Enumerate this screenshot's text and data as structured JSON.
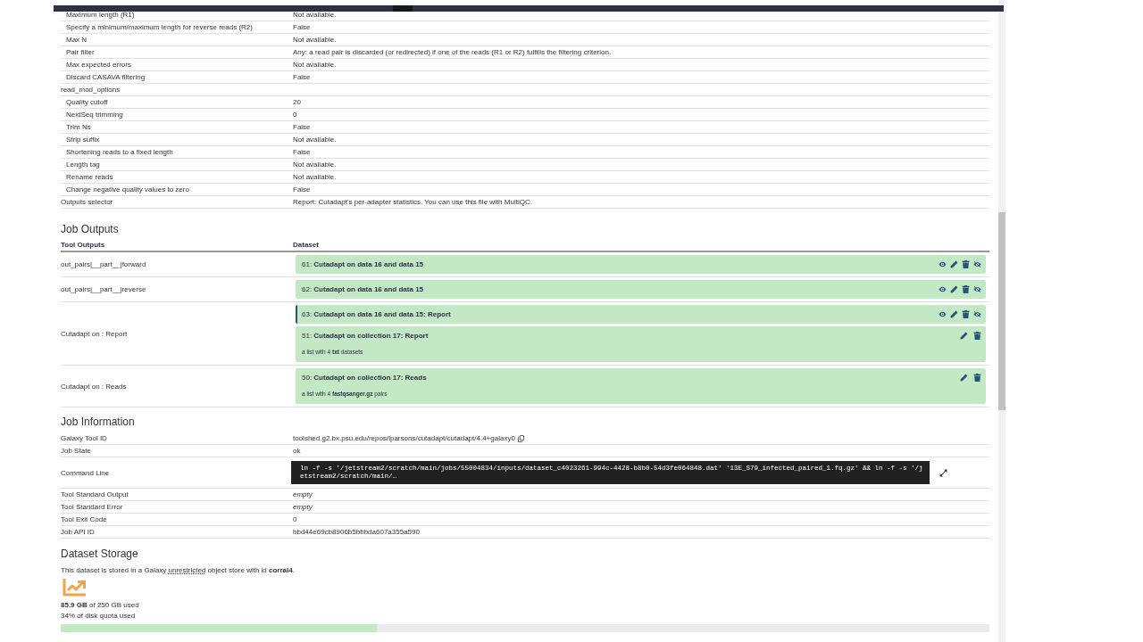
{
  "parameters": [
    {
      "children": [
        {
          "label": "Maximum length (R1)",
          "value": "Not available."
        },
        {
          "label": "Specify a minimum/maximum length for reverse reads (R2)",
          "value": "False"
        },
        {
          "label": "Max N",
          "value": "Not available."
        },
        {
          "label": "Pair filter",
          "value": "Any: a read pair is discarded (or redirected) if one of the reads (R1 or R2) fulfills the filtering criterion."
        },
        {
          "label": "Max expected errors",
          "value": "Not available."
        },
        {
          "label": "Discard CASAVA filtering",
          "value": "False"
        }
      ]
    },
    {
      "label": "read_mod_options",
      "children": [
        {
          "label": "Quality cutoff",
          "value": "20"
        },
        {
          "label": "NextSeq trimming",
          "value": "0"
        },
        {
          "label": "Trim Ns",
          "value": "False"
        },
        {
          "label": "Strip suffix",
          "value": "Not available."
        },
        {
          "label": "Shortening reads to a fixed length",
          "value": "False"
        },
        {
          "label": "Length tag",
          "value": "Not available."
        },
        {
          "label": "Rename reads",
          "value": "Not available."
        },
        {
          "label": "Change negative quality values to zero",
          "value": "False"
        }
      ]
    },
    {
      "label": "Outputs selector",
      "value": "Report: Cutadapt's per-adapter statistics. You can use this file with MultiQC."
    }
  ],
  "job_outputs": {
    "title": "Job Outputs",
    "columns": [
      "Tool Outputs",
      "Dataset"
    ],
    "rows": [
      {
        "name": "out_pairs|__part__|forward",
        "datasets": [
          {
            "kind": "dataset",
            "title": "61: **Cutadapt on data 16 and data 15**",
            "selected": false
          }
        ]
      },
      {
        "name": "out_pairs|__part__|reverse",
        "datasets": [
          {
            "kind": "dataset",
            "title": "62: **Cutadapt on data 16 and data 15**",
            "selected": false
          }
        ]
      },
      {
        "name": "Cutadapt on : Report",
        "datasets": [
          {
            "kind": "dataset",
            "title": "63: **Cutadapt on data 16 and data 15: Report**",
            "selected": true
          },
          {
            "kind": "collection",
            "title": "51: **Cutadapt on collection 17: Report**",
            "summary": "a list with 4 **txt** datasets",
            "selected": false
          }
        ]
      },
      {
        "name": "Cutadapt on : Reads",
        "datasets": [
          {
            "kind": "collection",
            "title": "50: **Cutadapt on collection 17: Reads**",
            "summary": "a list with 4 **fastqsanger.gz** pairs",
            "selected": false
          }
        ]
      }
    ]
  },
  "job_information": {
    "title": "Job Information",
    "rows": [
      {
        "kind": "copy",
        "label": "Galaxy Tool ID",
        "value": "toolshed.g2.bx.psu.edu/repos/lparsons/cutadapt/cutadapt/4.4+galaxy0"
      },
      {
        "kind": "text",
        "label": "Job State",
        "value": "ok"
      },
      {
        "kind": "command",
        "label": "Command Line",
        "value": "ln -f -s '/jetstream2/scratch/main/jobs/55004834/inputs/dataset_c4023261-994c-4428-b8b0-54d3fe064848.dat' '13E_S79_infected_paired_1.fq.gz' && ln -f -s '/jetstream2/scratch/main/…"
      },
      {
        "kind": "empty",
        "label": "Tool Standard Output",
        "value": "empty"
      },
      {
        "kind": "empty",
        "label": "Tool Standard Error",
        "value": "empty"
      },
      {
        "kind": "text",
        "label": "Tool Exit Code",
        "value": "0"
      },
      {
        "kind": "text",
        "label": "Job API ID",
        "value": "bbd44e69cb8906b5bbbda607a355a590"
      }
    ]
  },
  "dataset_storage": {
    "title": "Dataset Storage",
    "text_before": "This dataset is stored in a Galaxy",
    "term": "unrestricted",
    "text_after": "object store with id **corral4**.",
    "usage": "**85.9 GB** of 250 GB used",
    "quota": "34% of disk quota used",
    "level": 0.34
  }
}
